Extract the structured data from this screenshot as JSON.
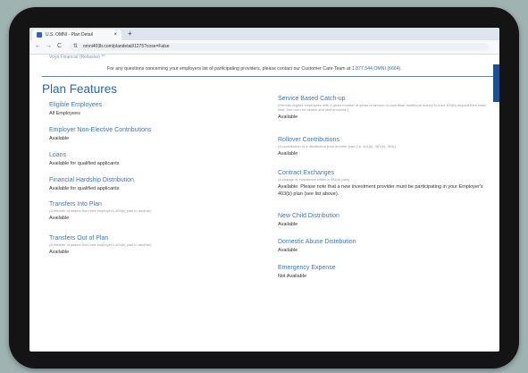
{
  "browser": {
    "tab_title": "U.S. OMNI - Plan Detail",
    "tab_close": "×",
    "new_tab": "+",
    "back": "←",
    "forward": "→",
    "reload": "C",
    "url": "omni403b.com/plandetail/1275?cose=False",
    "url_icon": "⇅"
  },
  "page": {
    "top_cut_text": "Voya Financial (Reliastar) **",
    "notice_text": "For any questions concerning your employers list of participating providers, please contact our Customer Care Team at ",
    "notice_phone": "1.877.544.OMNI (6664)",
    "notice_end": ".",
    "title": "Plan Features"
  },
  "features_left": [
    {
      "name": "Eligible Employees",
      "desc": "",
      "value": "All Employees"
    },
    {
      "name": "Employer Non-Elective Contributions",
      "desc": "",
      "value": "Available"
    },
    {
      "name": "Loans",
      "desc": "",
      "value": "Available for qualified applicants"
    },
    {
      "name": "Financial Hardship Distribution",
      "desc": "",
      "value": "Available for qualified applicants"
    },
    {
      "name": "Transfers Into Plan",
      "desc": "(A transfer of assets from one employer's 403(b) plan to another)",
      "value": "Available"
    },
    {
      "name": "Transfers Out of Plan",
      "desc": "(A transfer of assets from one employer's 403(b) plan to another)",
      "value": "Available"
    }
  ],
  "features_right": [
    {
      "name": "Service Based Catch-up",
      "desc": "(Permits eligible employees with a given number of years of service to contribute additional money to their 403(b) beyond their base limit. See form for details and limit amounts.)",
      "value": "Available"
    },
    {
      "name": "Rollover Contributions",
      "desc": "(A contribution of a distribution from another plan (i.e. 401(k), 457(b), IRA))",
      "value": "Available"
    },
    {
      "name": "Contract Exchanges",
      "desc": "(A change of investment within a 403(b) plan)",
      "value": "Available. Please note that a new investment provider must be participating in your Employer's 403(b) plan (see list above)."
    },
    {
      "name": "New Child Distribution",
      "desc": "",
      "value": "Available"
    },
    {
      "name": "Domestic Abuse Distribution",
      "desc": "",
      "value": "Available"
    },
    {
      "name": "Emergency Expense",
      "desc": "",
      "value": "Not Available"
    }
  ]
}
